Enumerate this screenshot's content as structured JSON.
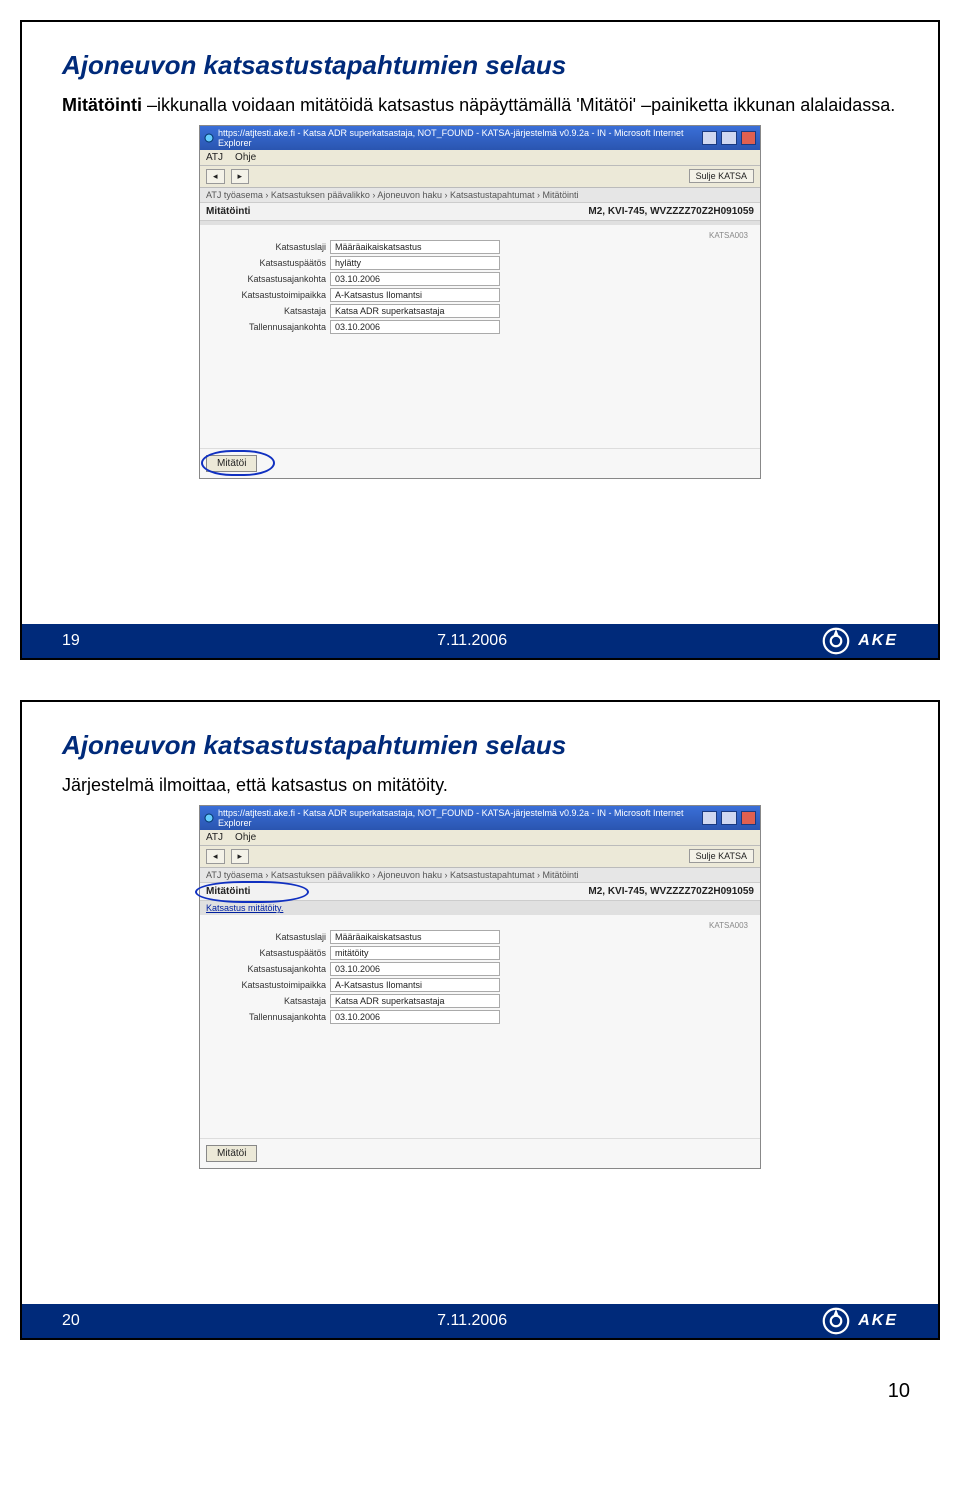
{
  "page_number": "10",
  "footer_brand": "AKE",
  "slides": [
    {
      "slide_no": "19",
      "date": "7.11.2006",
      "title": "Ajoneuvon katsastustapahtumien selaus",
      "body_bold": "Mitätöinti",
      "body_rest": " –ikkunalla voidaan mitätöidä katsastus näpäyttämällä 'Mitätöi' –painiketta ikkunan alalaidassa.",
      "ie_title": "https://atjtesti.ake.fi - Katsa ADR superkatsastaja, NOT_FOUND - KATSA-järjestelmä v0.9.2a - IN - Microsoft Internet Explorer",
      "menu1": "ATJ",
      "menu2": "Ohje",
      "btn_right": "Sulje KATSA",
      "crumb": "ATJ työasema › Katsastuksen päävalikko › Ajoneuvon haku › Katsastustapahtumat › Mitätöinti",
      "hdr_left": "Mitätöinti",
      "hdr_right": "M2, KVI-745, WVZZZZ70Z2H091059",
      "ref": "KATSA003",
      "status_msg": "",
      "fields": {
        "f1_label": "Katsastuslaji",
        "f1_val": "Määräaikaiskatsastus",
        "f2_label": "Katsastuspäätös",
        "f2_val": "hylätty",
        "f3_label": "Katsastusajankohta",
        "f3_val": "03.10.2006",
        "f4_label": "Katsastustoimipaikka",
        "f4_val": "A-Katsastus Ilomantsi",
        "f5_label": "Katsastaja",
        "f5_val": "Katsa ADR superkatsastaja",
        "f6_label": "Tallennusajankohta",
        "f6_val": "03.10.2006"
      },
      "btn_mit": "Mitätöi",
      "circle_button": true,
      "circle_status": false
    },
    {
      "slide_no": "20",
      "date": "7.11.2006",
      "title": "Ajoneuvon katsastustapahtumien selaus",
      "body_bold": "",
      "body_rest": "Järjestelmä ilmoittaa, että katsastus on mitätöity.",
      "ie_title": "https://atjtesti.ake.fi - Katsa ADR superkatsastaja, NOT_FOUND - KATSA-järjestelmä v0.9.2a - IN - Microsoft Internet Explorer",
      "menu1": "ATJ",
      "menu2": "Ohje",
      "btn_right": "Sulje KATSA",
      "crumb": "ATJ työasema › Katsastuksen päävalikko › Ajoneuvon haku › Katsastustapahtumat › Mitätöinti",
      "hdr_left": "Mitätöinti",
      "hdr_right": "M2, KVI-745, WVZZZZ70Z2H091059",
      "ref": "KATSA003",
      "status_msg": "Katsastus mitätöity.",
      "fields": {
        "f1_label": "Katsastuslaji",
        "f1_val": "Määräaikaiskatsastus",
        "f2_label": "Katsastuspäätös",
        "f2_val": "mitätöity",
        "f3_label": "Katsastusajankohta",
        "f3_val": "03.10.2006",
        "f4_label": "Katsastustoimipaikka",
        "f4_val": "A-Katsastus Ilomantsi",
        "f5_label": "Katsastaja",
        "f5_val": "Katsa ADR superkatsastaja",
        "f6_label": "Tallennusajankohta",
        "f6_val": "03.10.2006"
      },
      "btn_mit": "Mitätöi",
      "circle_button": false,
      "circle_status": true
    }
  ]
}
